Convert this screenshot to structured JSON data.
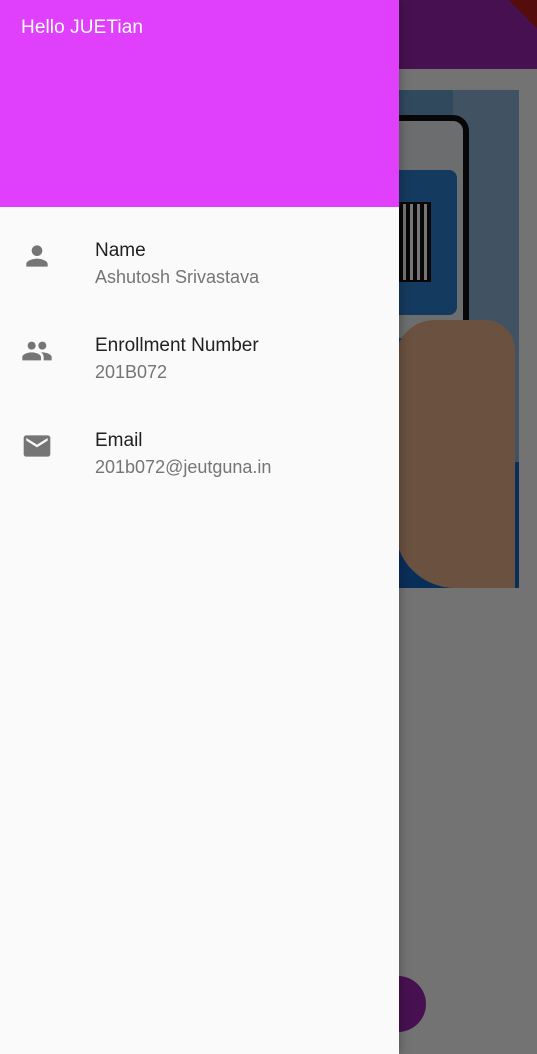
{
  "drawer": {
    "header_title": "Hello JUETian",
    "items": [
      {
        "title": "Name",
        "subtitle": "Ashutosh Srivastava",
        "icon": "person-icon"
      },
      {
        "title": "Enrollment Number",
        "subtitle": "201B072",
        "icon": "people-icon"
      },
      {
        "title": "Email",
        "subtitle": "201b072@jeutguna.in",
        "icon": "email-icon"
      }
    ]
  },
  "colors": {
    "drawer_header": "#e040fb",
    "appbar": "#9c27b0",
    "icon": "#757575"
  }
}
